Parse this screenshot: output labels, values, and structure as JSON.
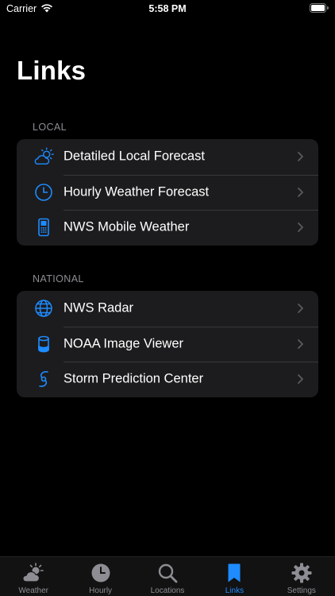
{
  "status_bar": {
    "carrier": "Carrier",
    "time": "5:58 PM"
  },
  "title": "Links",
  "sections": [
    {
      "header": "LOCAL",
      "items": [
        {
          "label": "Detatiled Local Forecast",
          "icon": "partly-cloudy-icon"
        },
        {
          "label": "Hourly Weather Forecast",
          "icon": "clock-icon"
        },
        {
          "label": "NWS Mobile Weather",
          "icon": "mobile-phone-icon"
        }
      ]
    },
    {
      "header": "NATIONAL",
      "items": [
        {
          "label": "NWS Radar",
          "icon": "globe-icon"
        },
        {
          "label": "NOAA Image Viewer",
          "icon": "cylinder-icon"
        },
        {
          "label": "Storm Prediction Center",
          "icon": "hurricane-icon"
        }
      ]
    }
  ],
  "tabs": [
    {
      "label": "Weather",
      "icon": "cloud-sun-icon",
      "active": false
    },
    {
      "label": "Hourly",
      "icon": "clock-icon",
      "active": false
    },
    {
      "label": "Locations",
      "icon": "search-icon",
      "active": false
    },
    {
      "label": "Links",
      "icon": "bookmark-icon",
      "active": true
    },
    {
      "label": "Settings",
      "icon": "gear-icon",
      "active": false
    }
  ],
  "colors": {
    "accent": "#1e8bff",
    "background": "#000000",
    "group_background": "#1c1c1e",
    "secondary_text": "#8d8d93"
  }
}
